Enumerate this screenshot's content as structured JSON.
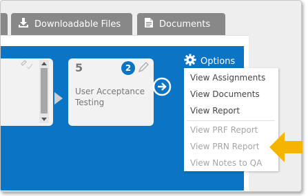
{
  "tabs": [
    {
      "label": ""
    },
    {
      "label": "Downloadable Files",
      "icon": "download-icon"
    },
    {
      "label": "Documents",
      "icon": "document-icon"
    }
  ],
  "colors": {
    "accent": "#0b74c4",
    "tab_bg": "#888888",
    "highlight_arrow": "#f5b400"
  },
  "workflow": {
    "step": {
      "number": "5",
      "label": "User Acceptance Testing",
      "badge": "2"
    }
  },
  "options": {
    "label": "Options",
    "items": [
      {
        "label": "View Assignments",
        "enabled": true
      },
      {
        "label": "View Documents",
        "enabled": true
      },
      {
        "label": "View Report",
        "enabled": true
      },
      {
        "label": "View PRF Report",
        "enabled": false
      },
      {
        "label": "View PRN Report",
        "enabled": false
      },
      {
        "label": "View Notes to QA",
        "enabled": false
      }
    ]
  }
}
